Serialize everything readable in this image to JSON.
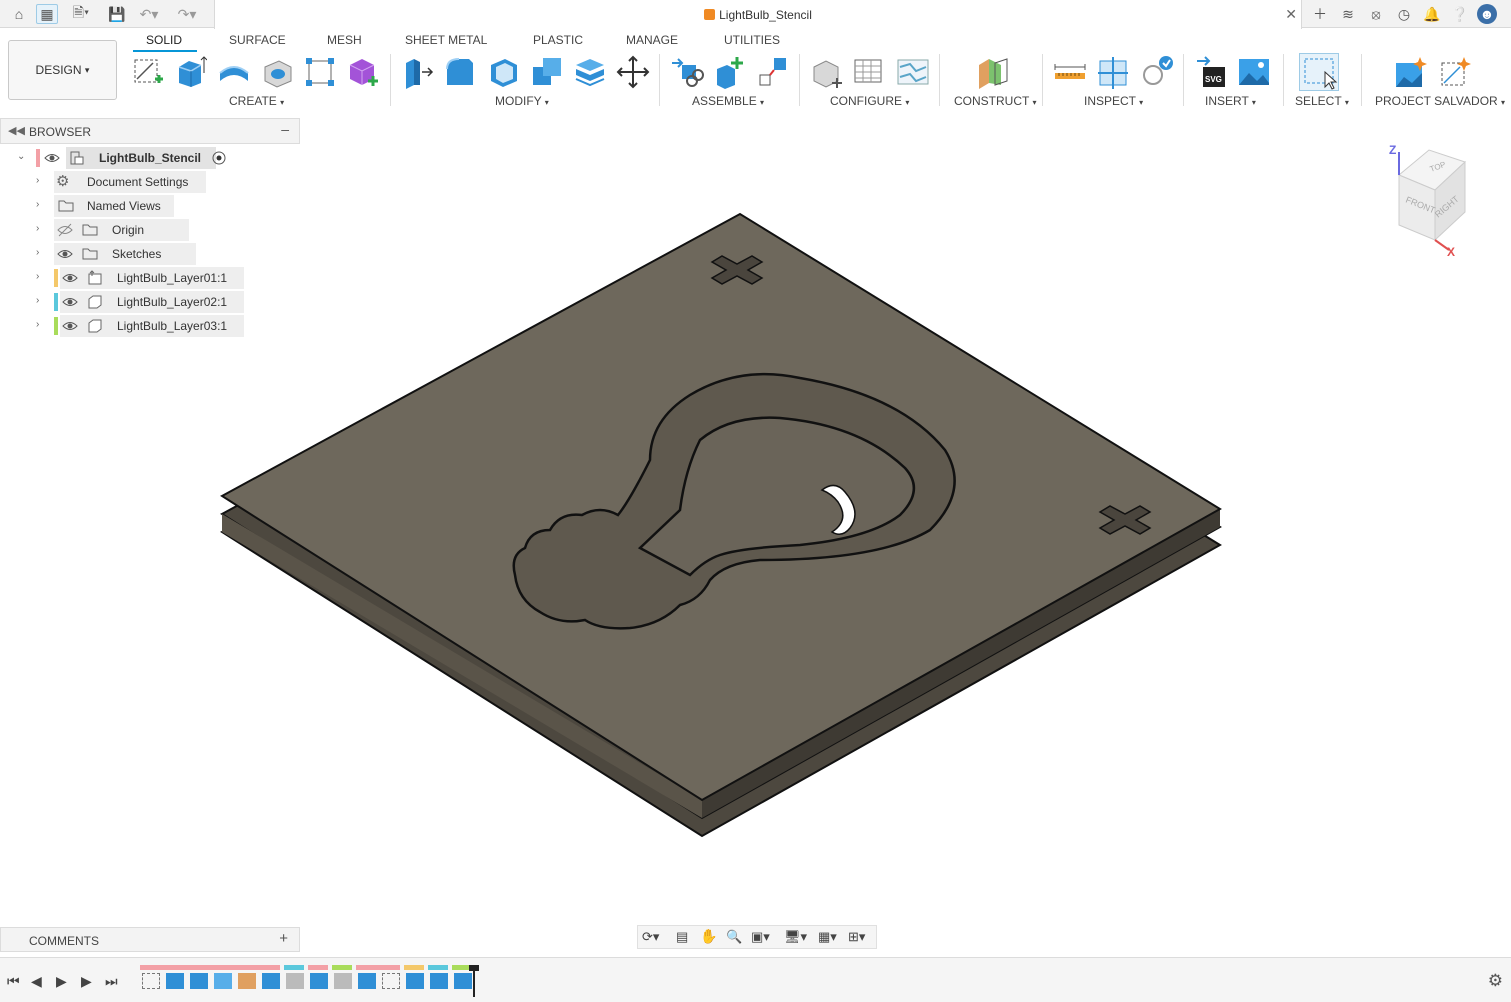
{
  "app": {
    "document_title": "LightBulb_Stencil"
  },
  "workspace": {
    "mode_label": "DESIGN"
  },
  "tabs": [
    "SOLID",
    "SURFACE",
    "MESH",
    "SHEET METAL",
    "PLASTIC",
    "MANAGE",
    "UTILITIES"
  ],
  "groups": [
    "CREATE",
    "MODIFY",
    "ASSEMBLE",
    "CONFIGURE",
    "CONSTRUCT",
    "INSPECT",
    "INSERT",
    "SELECT",
    "PROJECT SALVADOR"
  ],
  "browser": {
    "title": "BROWSER",
    "root": "LightBulb_Stencil",
    "items": [
      {
        "label": "Document Settings",
        "icon": "gear-icon"
      },
      {
        "label": "Named Views",
        "icon": "folder-icon"
      },
      {
        "label": "Origin",
        "icon": "folder-icon",
        "hidden": true
      },
      {
        "label": "Sketches",
        "icon": "folder-icon"
      },
      {
        "label": "LightBulb_Layer01:1",
        "icon": "component-icon",
        "color": "#f4c86a"
      },
      {
        "label": "LightBulb_Layer02:1",
        "icon": "component-icon",
        "color": "#5bc8dc"
      },
      {
        "label": "LightBulb_Layer03:1",
        "icon": "component-icon",
        "color": "#a9dc5b"
      }
    ]
  },
  "comments": {
    "title": "COMMENTS"
  },
  "viewcube": {
    "faces": [
      "TOP",
      "FRONT",
      "RIGHT"
    ],
    "axes": [
      "Z",
      "X"
    ]
  },
  "colors": {
    "accent": "#0696d7",
    "stencil": "#6e685c",
    "stencil_edge": "#4d483f"
  }
}
